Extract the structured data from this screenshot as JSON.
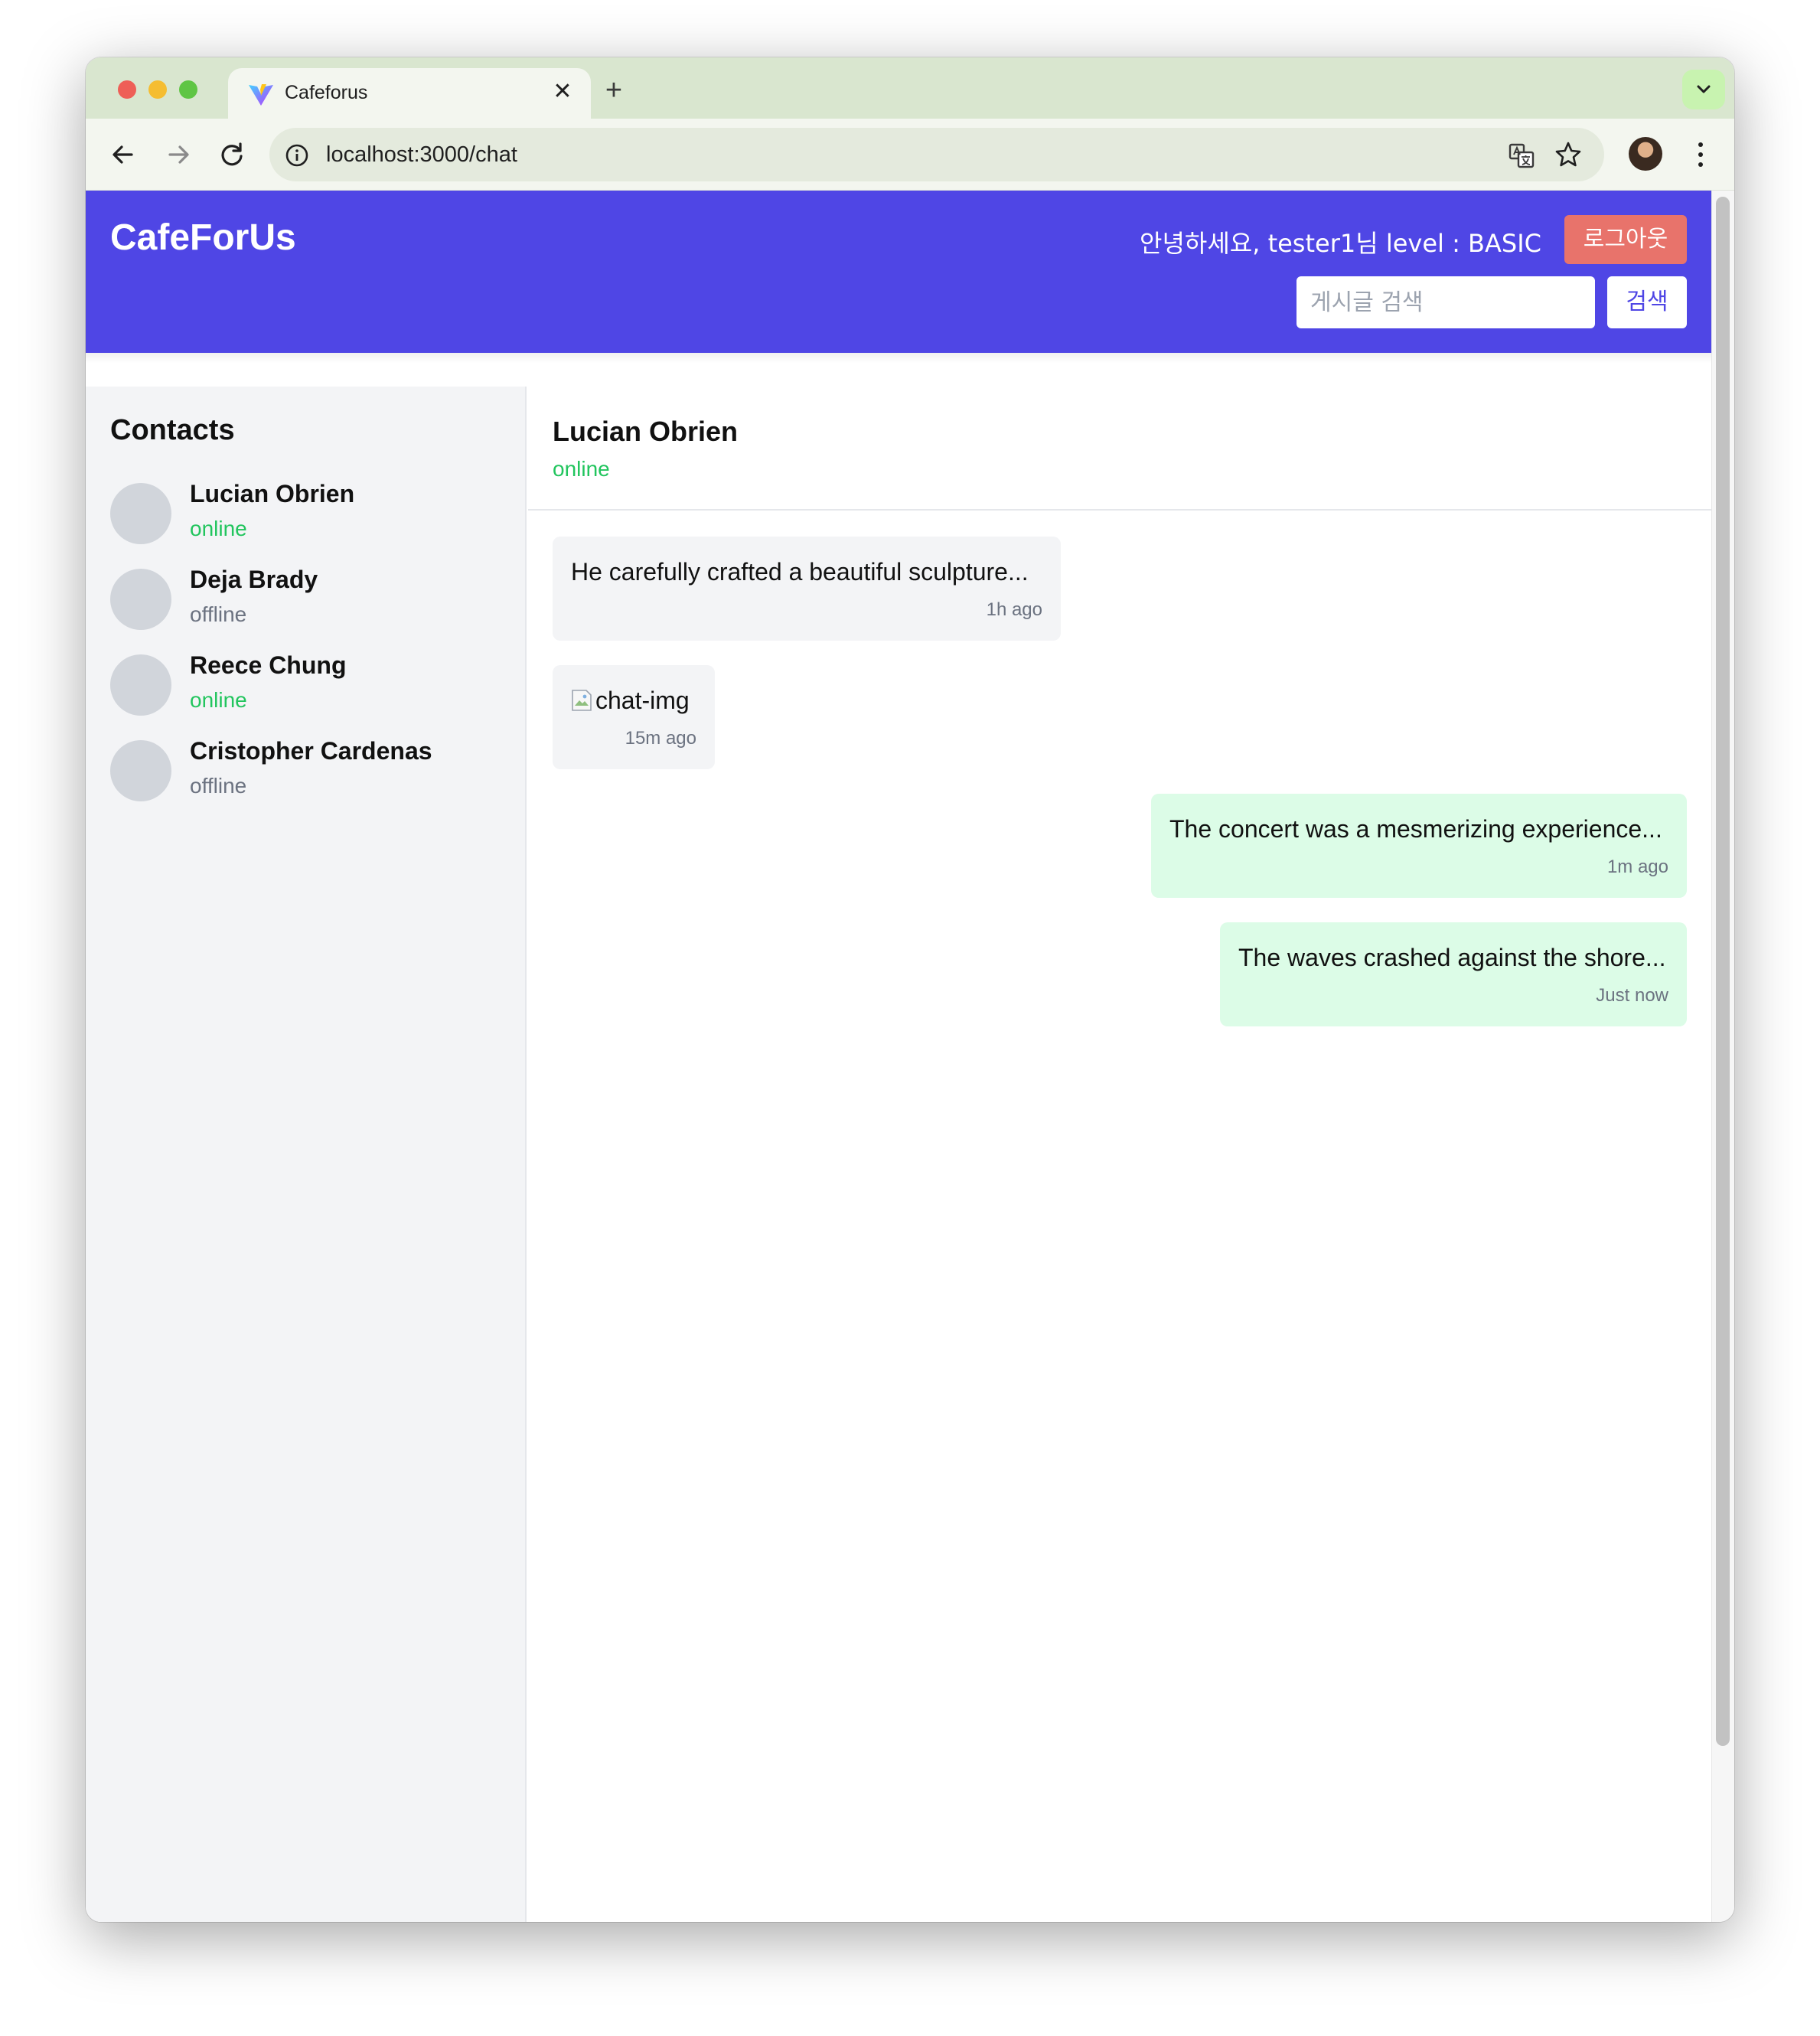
{
  "browser": {
    "tab_title": "Cafeforus",
    "tab_close_glyph": "✕",
    "new_tab_glyph": "+",
    "url": "localhost:3000/chat",
    "icons": [
      "back-icon",
      "forward-icon",
      "reload-icon",
      "info-icon",
      "translate-icon",
      "star-icon",
      "profile-avatar",
      "kebab-menu-icon",
      "tab-menu-chevron-icon"
    ]
  },
  "header": {
    "brand": "CafeForUs",
    "greeting": "안녕하세요, tester1님 level : BASIC",
    "logout_label": "로그아웃",
    "search_placeholder": "게시글 검색",
    "search_label": "검색",
    "colors": {
      "header_bg": "#4f46e5",
      "logout_bg": "#e8736b"
    }
  },
  "sidebar": {
    "title": "Contacts",
    "contacts": [
      {
        "name": "Lucian Obrien",
        "status": "online"
      },
      {
        "name": "Deja Brady",
        "status": "offline"
      },
      {
        "name": "Reece Chung",
        "status": "online"
      },
      {
        "name": "Cristopher Cardenas",
        "status": "offline"
      }
    ]
  },
  "chat": {
    "contact_name": "Lucian Obrien",
    "contact_status": "online",
    "messages": [
      {
        "direction": "incoming",
        "type": "text",
        "text": "He carefully crafted a beautiful sculpture...",
        "time": "1h ago"
      },
      {
        "direction": "incoming",
        "type": "image",
        "alt": "chat-img",
        "time": "15m ago"
      },
      {
        "direction": "outgoing",
        "type": "text",
        "text": "The concert was a mesmerizing experience...",
        "time": "1m ago"
      },
      {
        "direction": "outgoing",
        "type": "text",
        "text": "The waves crashed against the shore...",
        "time": "Just now"
      }
    ],
    "colors": {
      "incoming_bg": "#f3f4f6",
      "outgoing_bg": "#dcfce7",
      "online": "#22c55e",
      "offline": "#6b7280"
    }
  }
}
